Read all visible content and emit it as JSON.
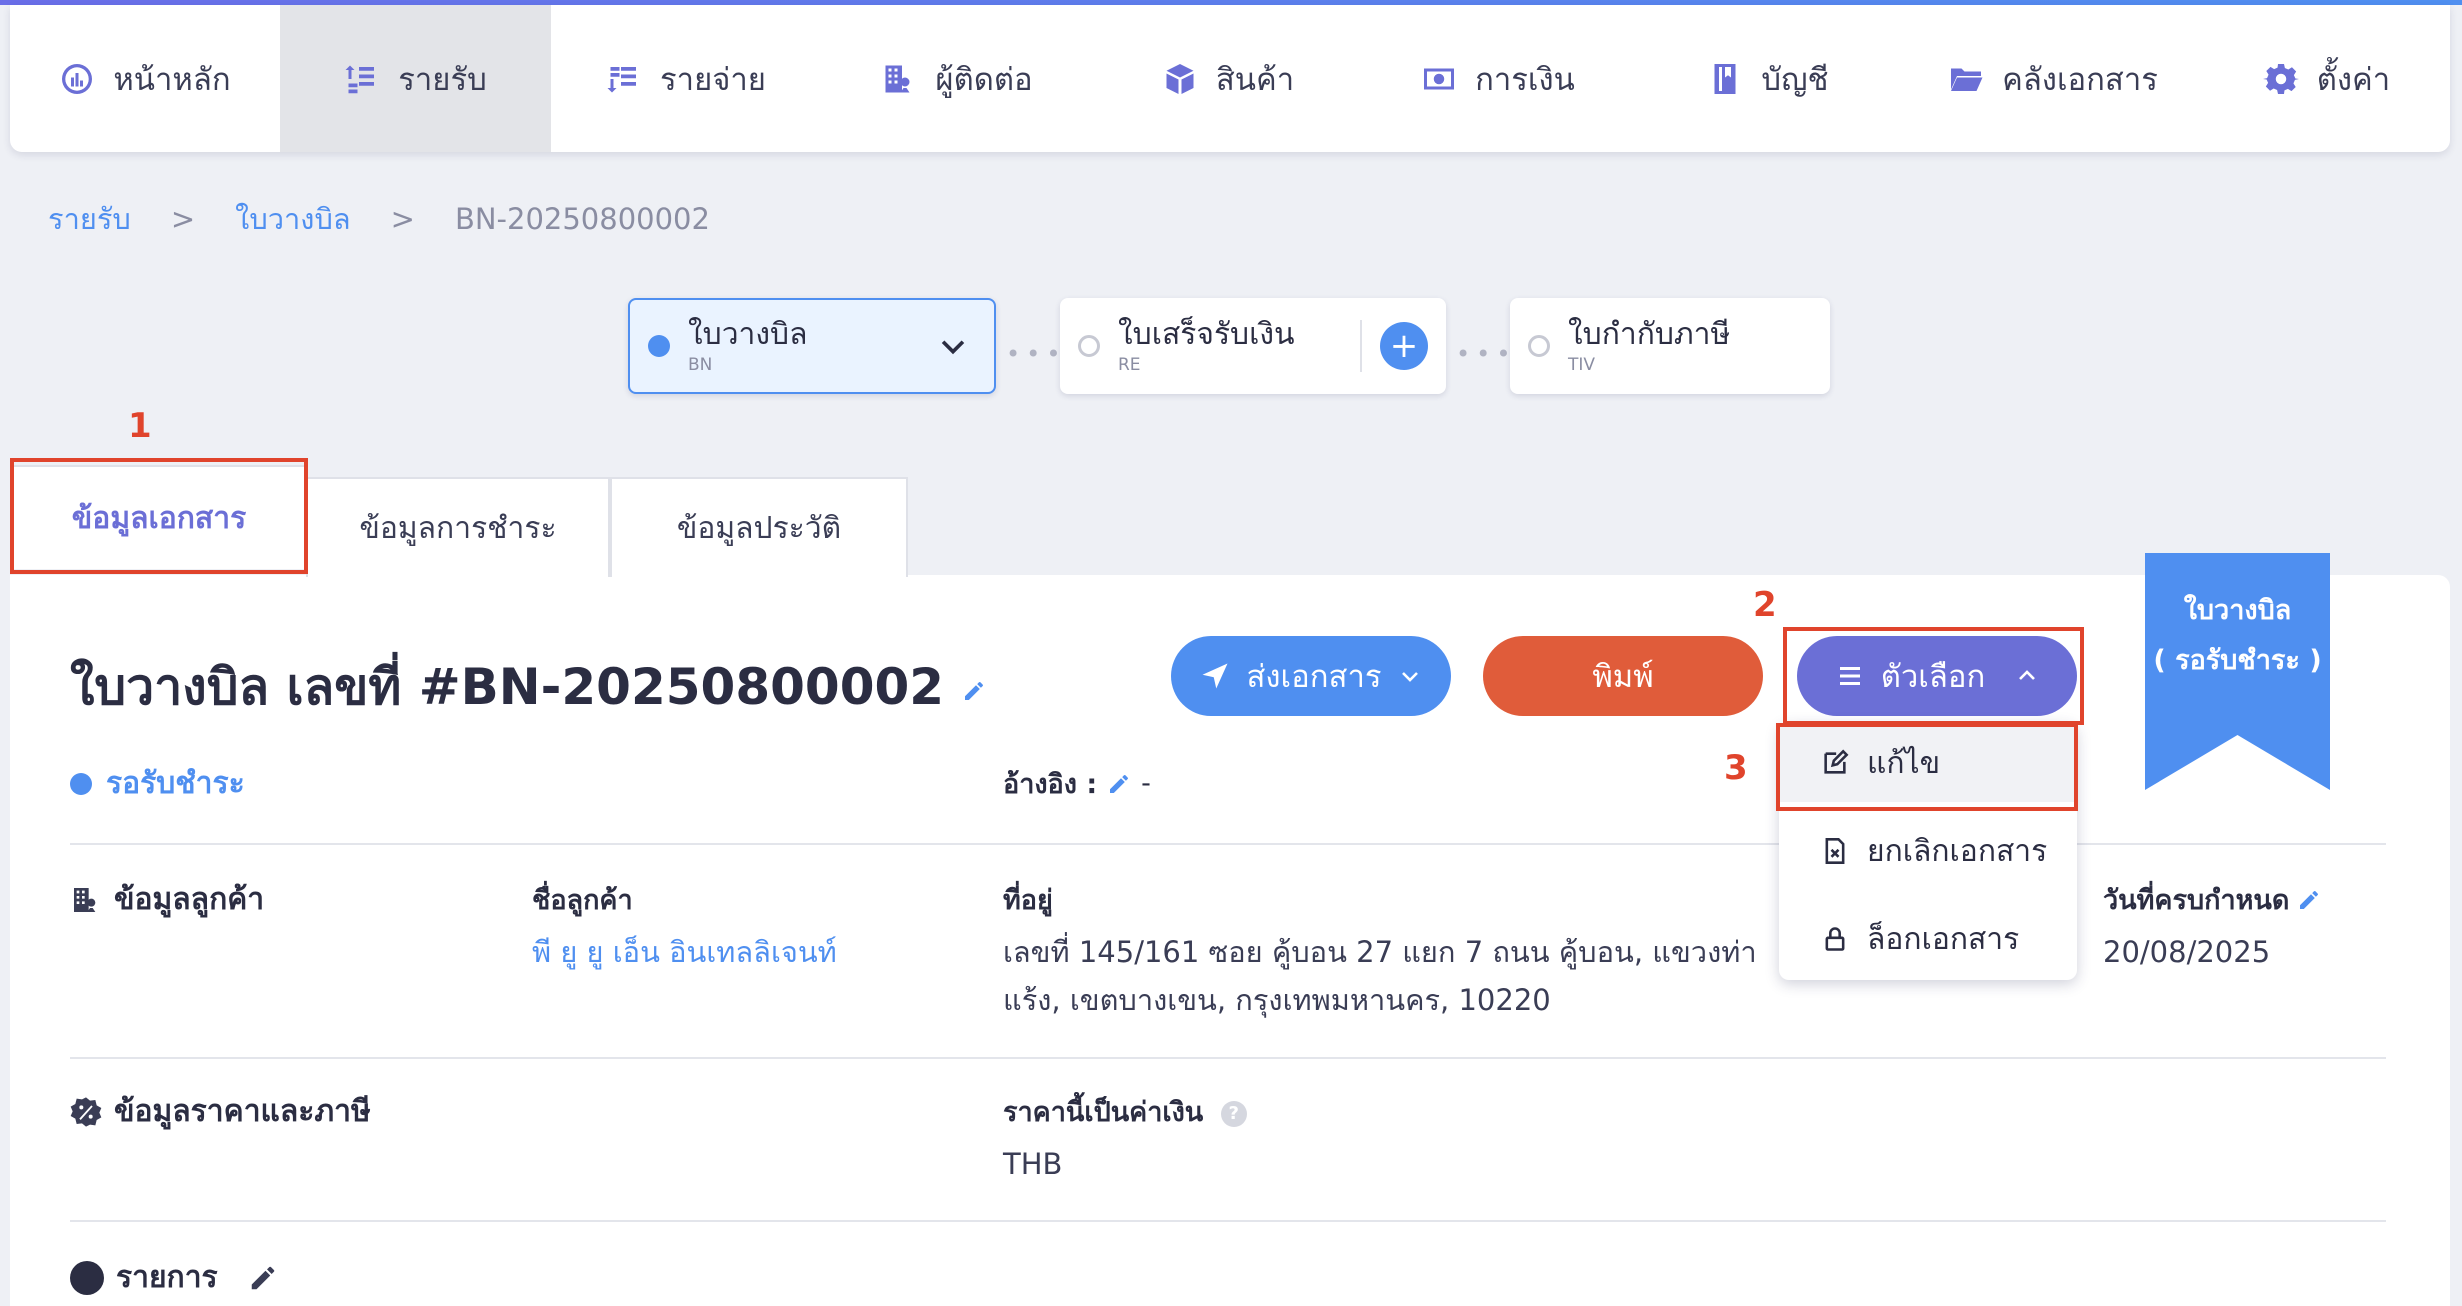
{
  "nav": {
    "items": [
      {
        "label": "หน้าหลัก",
        "icon": "dashboard-icon"
      },
      {
        "label": "รายรับ",
        "icon": "income-icon"
      },
      {
        "label": "รายจ่าย",
        "icon": "expense-icon"
      },
      {
        "label": "ผู้ติดต่อ",
        "icon": "contacts-icon"
      },
      {
        "label": "สินค้า",
        "icon": "box-icon"
      },
      {
        "label": "การเงิน",
        "icon": "money-icon"
      },
      {
        "label": "บัญชี",
        "icon": "book-icon"
      },
      {
        "label": "คลังเอกสาร",
        "icon": "folder-icon"
      },
      {
        "label": "ตั้งค่า",
        "icon": "gear-icon"
      }
    ],
    "active": "รายรับ"
  },
  "breadcrumb": {
    "items": [
      "รายรับ",
      "ใบวางบิล",
      "BN-20250800002"
    ],
    "separator": ">"
  },
  "flow": {
    "steps": [
      {
        "name": "ใบวางบิล",
        "code": "BN",
        "state": "active"
      },
      {
        "name": "ใบเสร็จรับเงิน",
        "code": "RE",
        "state": "pending"
      },
      {
        "name": "ใบกำกับภาษี",
        "code": "TIV",
        "state": "pending"
      }
    ],
    "dots": "•••"
  },
  "tabs": [
    {
      "label": "ข้อมูลเอกสาร",
      "active": true
    },
    {
      "label": "ข้อมูลการชำระ",
      "active": false
    },
    {
      "label": "ข้อมูลประวัติ",
      "active": false
    }
  ],
  "doc": {
    "title": "ใบวางบิล เลขที่ #BN-20250800002",
    "status": "รอรับชำระ",
    "reference_label": "อ้างอิง :",
    "reference_value": "-"
  },
  "actions": {
    "send_label": "ส่งเอกสาร",
    "print_label": "พิมพ์",
    "options_label": "ตัวเลือก",
    "menu": [
      {
        "label": "แก้ไข",
        "icon": "edit-icon"
      },
      {
        "label": "ยกเลิกเอกสาร",
        "icon": "cancel-doc-icon"
      },
      {
        "label": "ล็อกเอกสาร",
        "icon": "lock-icon"
      }
    ]
  },
  "ribbon": {
    "line1": "ใบวางบิล",
    "line2": "( รอรับชำระ )",
    "color": "#4f8ff0"
  },
  "customer": {
    "section_title": "ข้อมูลลูกค้า",
    "name_label": "ชื่อลูกค้า",
    "name_value": "พี ยู ยู เอ็น อินเทลลิเจนท์",
    "address_label": "ที่อยู่",
    "address_line1": "เลขที่ 145/161 ซอย คู้บอน 27 แยก 7 ถนน คู้บอน, แขวงท่า",
    "address_line2": "แร้ง, เขตบางเขน, กรุงเทพมหานคร, 10220",
    "due_label": "วันที่ครบกำหนด",
    "due_value": "20/08/2025"
  },
  "pricing": {
    "section_title": "ข้อมูลราคาและภาษี",
    "currency_label": "ราคานี้เป็นค่าเงิน",
    "currency_value": "THB"
  },
  "items_section": {
    "title": "รายการ"
  },
  "annotations": [
    "1",
    "2",
    "3"
  ],
  "colors": {
    "accent": "#6b6fd6",
    "primary_blue": "#4f8ff0",
    "print_orange": "#e05c3a",
    "highlight_red": "#e0442c"
  }
}
